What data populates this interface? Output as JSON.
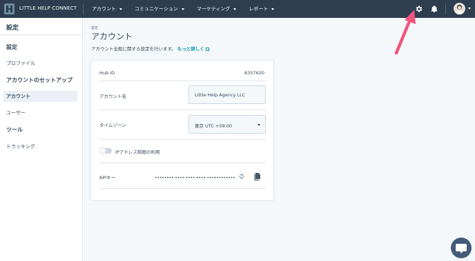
{
  "topbar": {
    "brand": "LITTLE HELP CONNECT",
    "nav": [
      {
        "label": "アカウント"
      },
      {
        "label": "コミュニケーション"
      },
      {
        "label": "マーケティング"
      },
      {
        "label": "レポート"
      }
    ],
    "icons": [
      "gear-icon",
      "bell-icon",
      "avatar"
    ]
  },
  "sidebar": {
    "title": "設定",
    "sections": [
      {
        "heading": "設定",
        "items": [
          "プロファイル"
        ]
      },
      {
        "heading": "アカウントのセットアップ",
        "items": [
          "アカウント",
          "ユーザー"
        ]
      },
      {
        "heading": "ツール",
        "items": [
          "トラッキング"
        ]
      }
    ],
    "active_item": "アカウント"
  },
  "main": {
    "breadcrumb": "設定",
    "title": "アカウント",
    "description": "アカウント全般に関する設定を行います。",
    "learn_more": "もっと詳しく",
    "hub_id_label": "Hub ID",
    "hub_id_value": "8357620",
    "account_name_label": "アカウント名",
    "account_name_value": "Little Help Agency LLC",
    "timezone_label": "タイムゾーン",
    "timezone_value": "東京 UTC +09:00",
    "ip_toggle_label": "IPアドレス制限の利用",
    "ip_toggle_on": false,
    "api_key_label": "APIキー",
    "api_key_value": "•••••••• •••• •••• •••• ••••••••••••"
  },
  "colors": {
    "topbar_bg": "#2d3e50",
    "link": "#0091ae",
    "annotation_arrow": "#f2547d",
    "chat_bubble": "#425b76"
  }
}
